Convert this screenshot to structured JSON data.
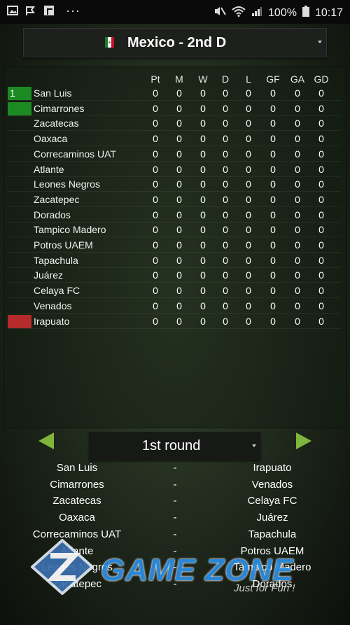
{
  "status_bar": {
    "battery": "100%",
    "time": "10:17",
    "dots": "···"
  },
  "league": {
    "title": "Mexico - 2nd D"
  },
  "columns": [
    "Pt",
    "M",
    "W",
    "D",
    "L",
    "GF",
    "GA",
    "GD"
  ],
  "standings": [
    {
      "pos": "1",
      "team": "San Luis",
      "stats": [
        "0",
        "0",
        "0",
        "0",
        "0",
        "0",
        "0",
        "0"
      ]
    },
    {
      "pos": "",
      "team": "Cimarrones",
      "stats": [
        "0",
        "0",
        "0",
        "0",
        "0",
        "0",
        "0",
        "0"
      ]
    },
    {
      "pos": "",
      "team": "Zacatecas",
      "stats": [
        "0",
        "0",
        "0",
        "0",
        "0",
        "0",
        "0",
        "0"
      ]
    },
    {
      "pos": "",
      "team": "Oaxaca",
      "stats": [
        "0",
        "0",
        "0",
        "0",
        "0",
        "0",
        "0",
        "0"
      ]
    },
    {
      "pos": "",
      "team": "Correcaminos UAT",
      "stats": [
        "0",
        "0",
        "0",
        "0",
        "0",
        "0",
        "0",
        "0"
      ]
    },
    {
      "pos": "",
      "team": "Atlante",
      "stats": [
        "0",
        "0",
        "0",
        "0",
        "0",
        "0",
        "0",
        "0"
      ]
    },
    {
      "pos": "",
      "team": "Leones Negros",
      "stats": [
        "0",
        "0",
        "0",
        "0",
        "0",
        "0",
        "0",
        "0"
      ]
    },
    {
      "pos": "",
      "team": "Zacatepec",
      "stats": [
        "0",
        "0",
        "0",
        "0",
        "0",
        "0",
        "0",
        "0"
      ]
    },
    {
      "pos": "",
      "team": "Dorados",
      "stats": [
        "0",
        "0",
        "0",
        "0",
        "0",
        "0",
        "0",
        "0"
      ]
    },
    {
      "pos": "",
      "team": "Tampico Madero",
      "stats": [
        "0",
        "0",
        "0",
        "0",
        "0",
        "0",
        "0",
        "0"
      ]
    },
    {
      "pos": "",
      "team": "Potros UAEM",
      "stats": [
        "0",
        "0",
        "0",
        "0",
        "0",
        "0",
        "0",
        "0"
      ]
    },
    {
      "pos": "",
      "team": "Tapachula",
      "stats": [
        "0",
        "0",
        "0",
        "0",
        "0",
        "0",
        "0",
        "0"
      ]
    },
    {
      "pos": "",
      "team": "Juárez",
      "stats": [
        "0",
        "0",
        "0",
        "0",
        "0",
        "0",
        "0",
        "0"
      ]
    },
    {
      "pos": "",
      "team": "Celaya FC",
      "stats": [
        "0",
        "0",
        "0",
        "0",
        "0",
        "0",
        "0",
        "0"
      ]
    },
    {
      "pos": "",
      "team": "Venados",
      "stats": [
        "0",
        "0",
        "0",
        "0",
        "0",
        "0",
        "0",
        "0"
      ]
    },
    {
      "pos": "",
      "team": "Irapuato",
      "stats": [
        "0",
        "0",
        "0",
        "0",
        "0",
        "0",
        "0",
        "0"
      ]
    }
  ],
  "round": {
    "label": "1st round"
  },
  "fixtures": [
    {
      "home": "San Luis",
      "sep": "-",
      "away": "Irapuato"
    },
    {
      "home": "Cimarrones",
      "sep": "-",
      "away": "Venados"
    },
    {
      "home": "Zacatecas",
      "sep": "-",
      "away": "Celaya FC"
    },
    {
      "home": "Oaxaca",
      "sep": "-",
      "away": "Juárez"
    },
    {
      "home": "Correcaminos UAT",
      "sep": "-",
      "away": "Tapachula"
    },
    {
      "home": "Atlante",
      "sep": "-",
      "away": "Potros UAEM"
    },
    {
      "home": "Leones Negros",
      "sep": "-",
      "away": "Tampico Madero"
    },
    {
      "home": "Zacatepec",
      "sep": "-",
      "away": "Dorados"
    }
  ],
  "watermark": {
    "title": "GAME ZONE",
    "tagline": "Just for Fun !"
  },
  "colors": {
    "promotion": "#1c8a22",
    "relegation": "#b52a2a",
    "nav_arrow": "#7fb53a",
    "watermark": "#2b8fe6"
  }
}
